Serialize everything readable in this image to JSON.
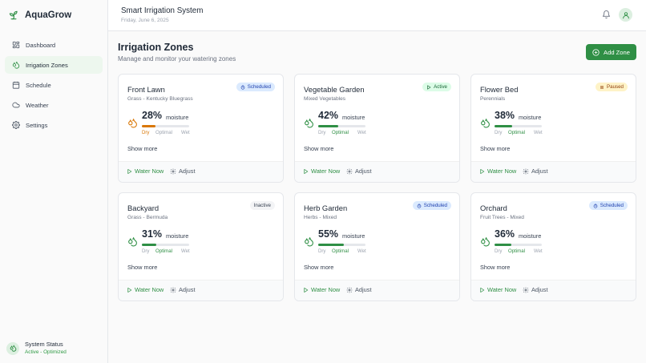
{
  "app": {
    "name": "AquaGrow",
    "accent": "#2f8f45"
  },
  "sidebar": {
    "items": [
      {
        "label": "Dashboard",
        "icon": "dashboard-icon",
        "active": false
      },
      {
        "label": "Irrigation Zones",
        "icon": "droplets-icon",
        "active": true
      },
      {
        "label": "Schedule",
        "icon": "calendar-icon",
        "active": false
      },
      {
        "label": "Weather",
        "icon": "cloud-icon",
        "active": false
      },
      {
        "label": "Settings",
        "icon": "gear-icon",
        "active": false
      }
    ],
    "status": {
      "title": "System Status",
      "subtitle": "Active - Optimized"
    }
  },
  "header": {
    "title": "Smart Irrigation System",
    "date": "Friday, June 6, 2025"
  },
  "main": {
    "title": "Irrigation Zones",
    "subtitle": "Manage and monitor your watering zones",
    "add_button": "Add Zone"
  },
  "labels": {
    "moisture": "moisture",
    "dry": "Dry",
    "optimal": "Optimal",
    "wet": "Wet",
    "show_more": "Show more",
    "water_now": "Water Now",
    "adjust": "Adjust"
  },
  "zones": [
    {
      "name": "Front Lawn",
      "type": "Grass - Kentucky Bluegrass",
      "status": "Scheduled",
      "moisture": "28%",
      "level": "dry",
      "fill": 0.28
    },
    {
      "name": "Vegetable Garden",
      "type": "Mixed Vegetables",
      "status": "Active",
      "moisture": "42%",
      "level": "optimal",
      "fill": 0.42
    },
    {
      "name": "Flower Bed",
      "type": "Perennials",
      "status": "Paused",
      "moisture": "38%",
      "level": "optimal",
      "fill": 0.38
    },
    {
      "name": "Backyard",
      "type": "Grass - Bermuda",
      "status": "Inactive",
      "moisture": "31%",
      "level": "optimal",
      "fill": 0.31
    },
    {
      "name": "Herb Garden",
      "type": "Herbs - Mixed",
      "status": "Scheduled",
      "moisture": "55%",
      "level": "optimal",
      "fill": 0.55
    },
    {
      "name": "Orchard",
      "type": "Fruit Trees - Mixed",
      "status": "Scheduled",
      "moisture": "36%",
      "level": "optimal",
      "fill": 0.36
    }
  ],
  "colors": {
    "dry": "#d97706",
    "optimal": "#2f8f45"
  }
}
